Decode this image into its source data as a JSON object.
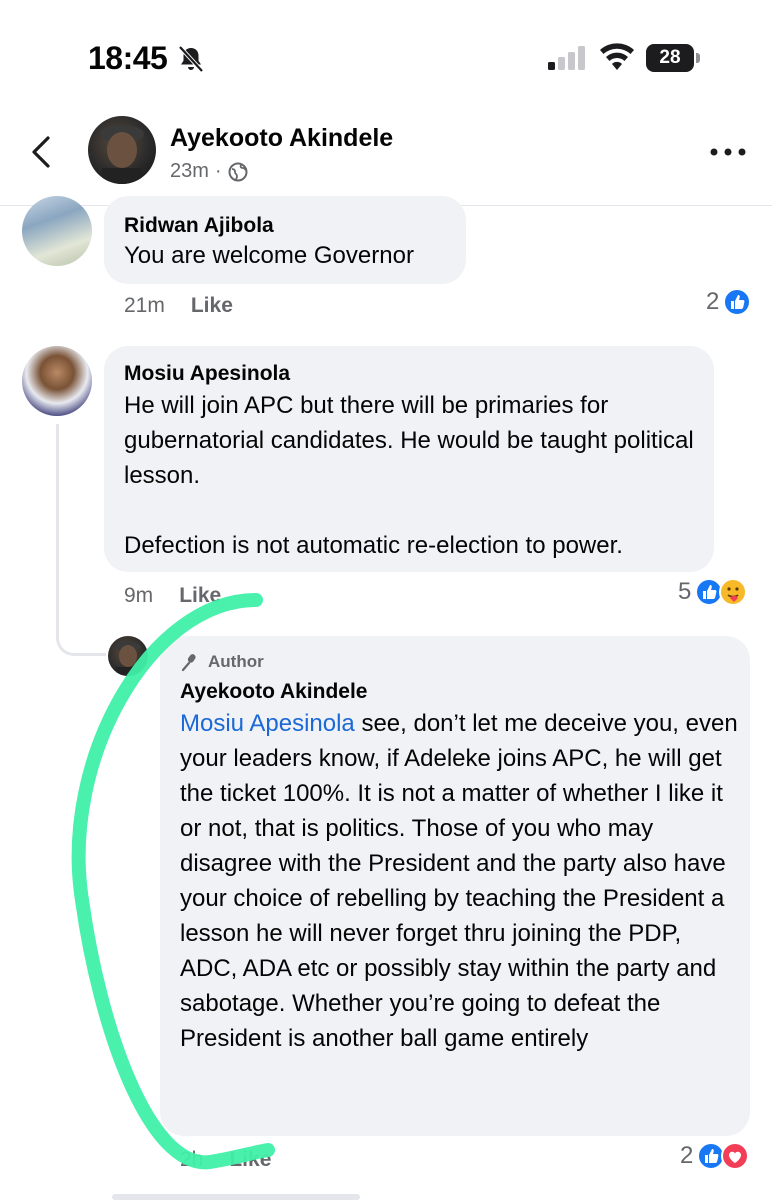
{
  "status_bar": {
    "time": "18:45",
    "battery": "28"
  },
  "header": {
    "name": "Ayekooto Akindele",
    "time": "23m",
    "separator": "·"
  },
  "comments": [
    {
      "name": "Ridwan Ajibola",
      "text": "You are welcome Governor",
      "time": "21m",
      "like_label": "Like",
      "reaction_count": "2"
    },
    {
      "name": "Mosiu Apesinola",
      "paragraphs": [
        "He will join APC but there will be primaries for gubernatorial candidates. He would be taught political lesson.",
        "Defection is not automatic re-election to power."
      ],
      "time": "9m",
      "like_label": "Like",
      "reaction_count": "5"
    }
  ],
  "reply": {
    "badge": "Author",
    "name": "Ayekooto Akindele",
    "mention": "Mosiu Apesinola",
    "text": " see, don’t let me deceive you, even your leaders know, if Adeleke joins APC, he will get the ticket 100%. It is not a matter of whether I like it or not, that is politics. Those of you who may disagree with the President and the party also have your choice of rebelling by teaching the President a lesson he will never forget thru joining the PDP, ADC, ADA etc or possibly stay within the party and sabotage. Whether you’re going to defeat the President is another ball game entirely",
    "time": "2h",
    "like_label": "Like",
    "reaction_count": "2"
  },
  "colors": {
    "accent": "#1877f2",
    "mention": "#1b69d6",
    "bubble": "#f0f2f5",
    "meta": "#65676b",
    "annotation_stroke": "#3ff0a8"
  }
}
